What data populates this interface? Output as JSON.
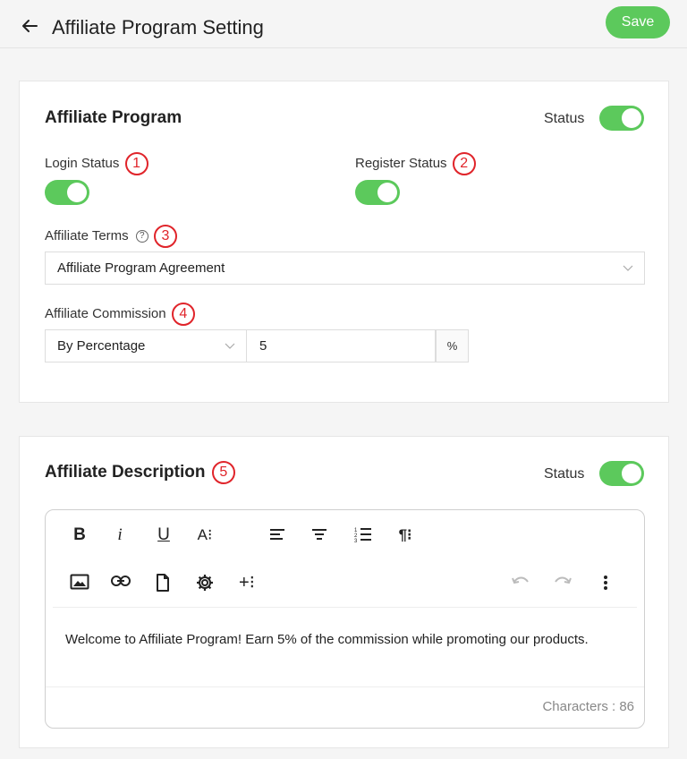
{
  "header": {
    "title": "Affiliate Program Setting",
    "save_label": "Save"
  },
  "program": {
    "title": "Affiliate Program",
    "status_label": "Status",
    "status_on": true,
    "login_status": {
      "label": "Login Status",
      "badge": "1",
      "on": true
    },
    "register_status": {
      "label": "Register Status",
      "badge": "2",
      "on": true
    },
    "terms": {
      "label": "Affiliate Terms",
      "badge": "3",
      "help": "?",
      "value": "Affiliate Program Agreement"
    },
    "commission": {
      "label": "Affiliate Commission",
      "badge": "4",
      "type": "By Percentage",
      "amount": "5",
      "unit": "%"
    }
  },
  "description": {
    "title": "Affiliate Description",
    "badge": "5",
    "status_label": "Status",
    "status_on": true,
    "toolbar": {
      "bold": "B",
      "italic": "i",
      "underline": "U",
      "font": "A⁝",
      "paragraph": "¶⁝",
      "insert": "+⁝"
    },
    "content": "Welcome to Affiliate Program! Earn 5% of the commission while promoting our products.",
    "char_label": "Characters : 86"
  },
  "colors": {
    "accent": "#5cc95c",
    "badge": "#e0242a"
  }
}
